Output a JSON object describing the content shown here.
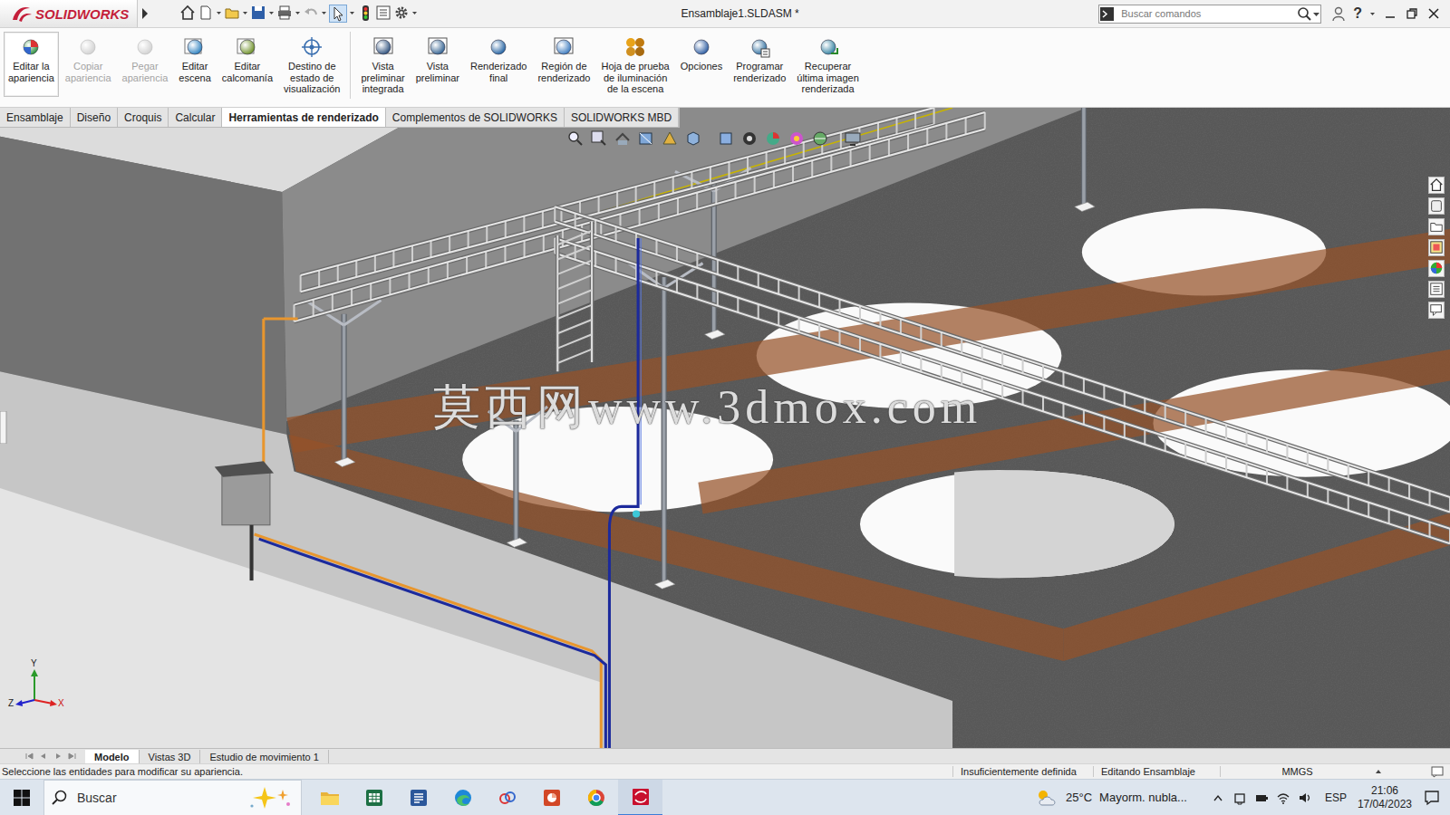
{
  "window": {
    "logo": "SOLIDWORKS",
    "title": "Ensamblaje1.SLDASM *",
    "search": {
      "placeholder": "Buscar comandos"
    },
    "help": "?"
  },
  "ribbon": [
    {
      "lines": [
        "Editar la",
        "apariencia"
      ],
      "selected": true,
      "disabled": false
    },
    {
      "lines": [
        "Copiar",
        "apariencia"
      ],
      "selected": false,
      "disabled": true
    },
    {
      "lines": [
        "Pegar",
        "apariencia"
      ],
      "selected": false,
      "disabled": true
    },
    {
      "lines": [
        "Editar",
        "escena"
      ],
      "selected": false,
      "disabled": false
    },
    {
      "lines": [
        "Editar",
        "calcomanía"
      ],
      "selected": false,
      "disabled": false
    },
    {
      "lines": [
        "Destino de",
        "estado de",
        "visualización"
      ],
      "selected": false,
      "disabled": false
    },
    {
      "lines": [
        "Vista",
        "preliminar",
        "integrada"
      ],
      "selected": false,
      "disabled": false
    },
    {
      "lines": [
        "Vista",
        "preliminar"
      ],
      "selected": false,
      "disabled": false
    },
    {
      "lines": [
        "Renderizado",
        "final"
      ],
      "selected": false,
      "disabled": false
    },
    {
      "lines": [
        "Región de",
        "renderizado"
      ],
      "selected": false,
      "disabled": false
    },
    {
      "lines": [
        "Hoja de prueba",
        "de iluminación",
        "de la escena"
      ],
      "selected": false,
      "disabled": false
    },
    {
      "lines": [
        "Opciones"
      ],
      "selected": false,
      "disabled": false
    },
    {
      "lines": [
        "Programar",
        "renderizado"
      ],
      "selected": false,
      "disabled": false
    },
    {
      "lines": [
        "Recuperar",
        "última imagen",
        "renderizada"
      ],
      "selected": false,
      "disabled": false
    }
  ],
  "tabs": [
    {
      "label": "Ensamblaje",
      "selected": false
    },
    {
      "label": "Diseño",
      "selected": false
    },
    {
      "label": "Croquis",
      "selected": false
    },
    {
      "label": "Calcular",
      "selected": false
    },
    {
      "label": "Herramientas de renderizado",
      "selected": true
    },
    {
      "label": "Complementos de SOLIDWORKS",
      "selected": false
    },
    {
      "label": "SOLIDWORKS MBD",
      "selected": false
    }
  ],
  "viewport": {
    "watermark": "莫西网www.3dmox.com",
    "triad": [
      "Y",
      "X",
      "Z"
    ]
  },
  "bottom_tabs": [
    {
      "label": "Modelo",
      "selected": true
    },
    {
      "label": "Vistas 3D",
      "selected": false
    },
    {
      "label": "Estudio de movimiento 1",
      "selected": false
    }
  ],
  "status_bar": {
    "message": "Seleccione las entidades para modificar su apariencia.",
    "fields": [
      "Insuficientemente definida",
      "Editando Ensamblaje",
      "MMGS"
    ]
  },
  "taskbar": {
    "search": {
      "placeholder": "Buscar"
    },
    "weather": "25°C",
    "weather_text": "Mayorm. nubla...",
    "language": "ESP",
    "time": "21:06",
    "date": "17/04/2023"
  }
}
